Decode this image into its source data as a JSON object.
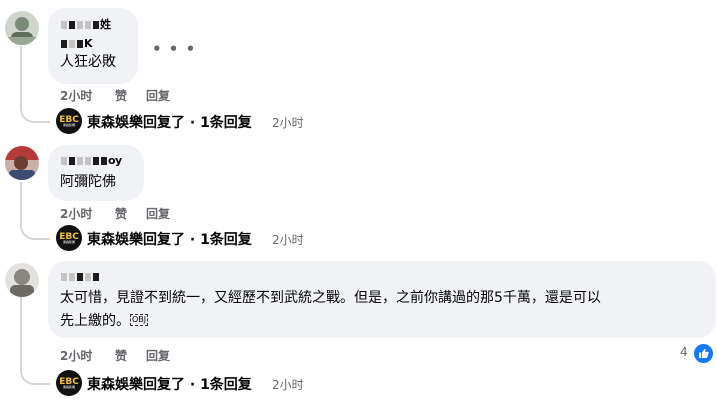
{
  "comments": [
    {
      "author_tail": "姓",
      "author_line2": "K",
      "text": "人狂必敗",
      "time": "2小时",
      "like_label": "赞",
      "reply_label": "回复",
      "page_reply": {
        "name": "東森娛樂回复了",
        "count": "· 1条回复",
        "time": "2小时"
      }
    },
    {
      "author_tail": "oy",
      "text": "阿彌陀佛",
      "time": "2小时",
      "like_label": "赞",
      "reply_label": "回复",
      "page_reply": {
        "name": "東森娛樂回复了",
        "count": "· 1条回复",
        "time": "2小时"
      }
    },
    {
      "author_tail": "",
      "text_line1": "太可惜，見證不到統一，又經歷不到武統之戰。但是，之前你講過的那5千萬，還是可以",
      "text_line2": "先上繳的。",
      "emoji_text": "OBJ",
      "time": "2小时",
      "like_label": "赞",
      "reply_label": "回复",
      "reaction_count": "4",
      "page_reply": {
        "name": "東森娛樂回复了",
        "count": "· 1条回复",
        "time": "2小时"
      }
    }
  ],
  "more_options": "• • •",
  "page_logo": {
    "text": "EBC",
    "subtext": "東森新聞"
  },
  "icons": {
    "like": "thumbs-up-icon",
    "more": "more-options-icon"
  },
  "colors": {
    "bubble": "#f0f2f5",
    "secondary_text": "#65676b",
    "like_blue": "#1877f2",
    "logo_bg": "#111111",
    "logo_fg": "#f2c230"
  }
}
